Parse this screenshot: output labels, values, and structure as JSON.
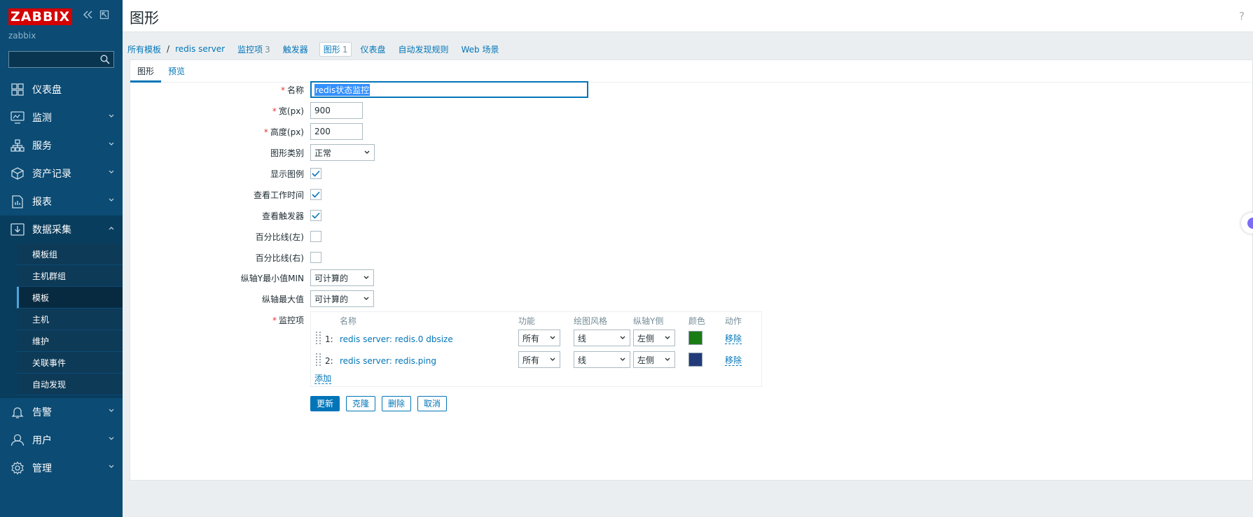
{
  "brand": {
    "logo": "ZABBIX",
    "server": "zabbix"
  },
  "sidebar": {
    "search_placeholder": "",
    "items": [
      {
        "label": "仪表盘"
      },
      {
        "label": "监测"
      },
      {
        "label": "服务"
      },
      {
        "label": "资产记录"
      },
      {
        "label": "报表"
      },
      {
        "label": "数据采集"
      },
      {
        "label": "告警"
      },
      {
        "label": "用户"
      },
      {
        "label": "管理"
      }
    ],
    "sub_items": [
      {
        "label": "模板组"
      },
      {
        "label": "主机群组"
      },
      {
        "label": "模板"
      },
      {
        "label": "主机"
      },
      {
        "label": "维护"
      },
      {
        "label": "关联事件"
      },
      {
        "label": "自动发现"
      }
    ]
  },
  "header": {
    "title": "图形",
    "help": "?"
  },
  "breadcrumbs": {
    "all_templates": "所有模板",
    "separator": "/",
    "host": "redis server",
    "items_label": "监控项",
    "items_count": "3",
    "triggers_label": "触发器",
    "graphs_label": "图形",
    "graphs_count": "1",
    "dashboards_label": "仪表盘",
    "discovery_label": "自动发现规则",
    "web_label": "Web 场景"
  },
  "tabs": {
    "graph": "图形",
    "preview": "预览"
  },
  "form": {
    "name_label": "名称",
    "name_value": "redis状态监控",
    "width_label": "宽(px)",
    "width_value": "900",
    "height_label": "高度(px)",
    "height_value": "200",
    "type_label": "图形类别",
    "type_value": "正常",
    "show_legend_label": "显示图例",
    "show_legend": true,
    "working_time_label": "查看工作时间",
    "working_time": true,
    "triggers_label": "查看触发器",
    "triggers": true,
    "percentile_left_label": "百分比线(左)",
    "percentile_left": false,
    "percentile_right_label": "百分比线(右)",
    "percentile_right": false,
    "ymin_label": "纵轴Y最小值MIN",
    "ymin_value": "可计算的",
    "ymax_label": "纵轴最大值",
    "ymax_value": "可计算的",
    "items_label": "监控项"
  },
  "items_table": {
    "headers": {
      "name": "名称",
      "function": "功能",
      "draw_style": "绘图风格",
      "y_axis": "纵轴Y侧",
      "color": "颜色",
      "action": "动作"
    },
    "rows": [
      {
        "num": "1:",
        "name": "redis server: redis.0 dbsize",
        "function": "所有",
        "draw_style": "线",
        "y_axis": "左侧",
        "color": "#1a7c14",
        "action": "移除"
      },
      {
        "num": "2:",
        "name": "redis server: redis.ping",
        "function": "所有",
        "draw_style": "线",
        "y_axis": "左侧",
        "color": "#233a7a",
        "action": "移除"
      }
    ],
    "add_label": "添加"
  },
  "buttons": {
    "update": "更新",
    "clone": "克隆",
    "delete": "删除",
    "cancel": "取消"
  },
  "colors": {
    "sidebar": "#0b4b74",
    "accent": "#0275b8",
    "logo": "#d40000"
  }
}
